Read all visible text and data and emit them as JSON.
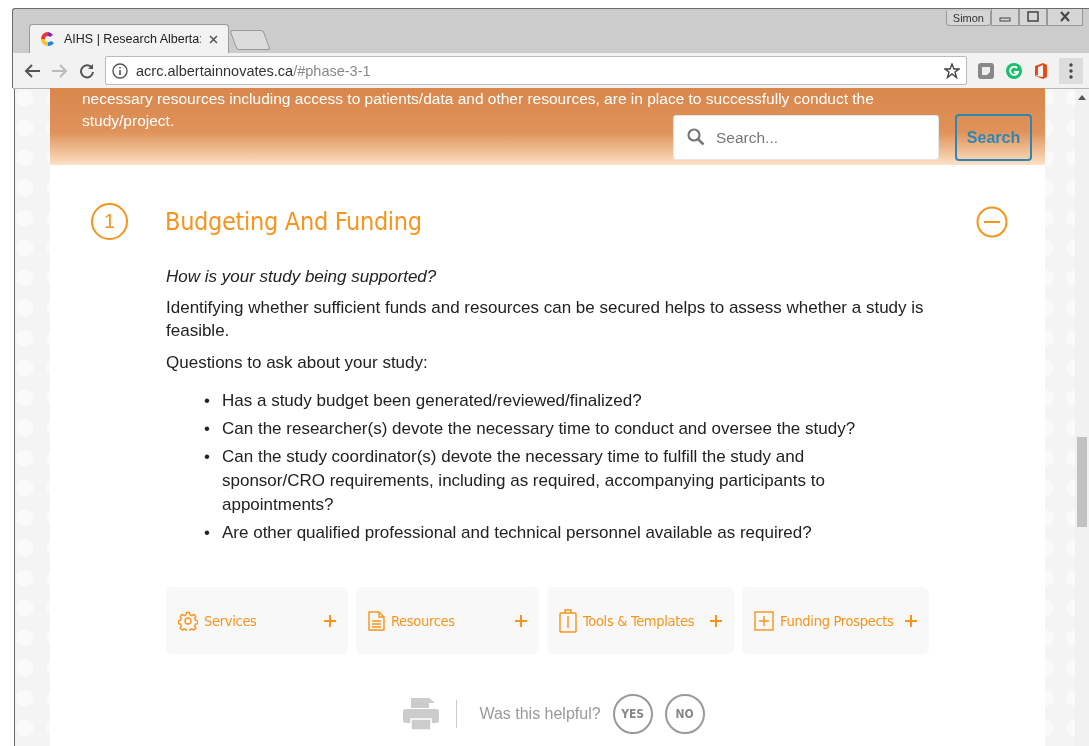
{
  "browser": {
    "tab_title": "AIHS | Research Alberta:",
    "profile": "Simon",
    "url_host": "acrc.albertainnovates.ca",
    "url_path": "/#phase-3-1"
  },
  "banner": {
    "text": "necessary resources including access to patients/data and other resources, are in place to successfully conduct the study/project.",
    "search": {
      "placeholder": "Search..."
    },
    "search_button": "Search"
  },
  "section": {
    "number": "1",
    "marker": "•",
    "title": "Budgeting And Funding",
    "expanded": true,
    "question": "How is your study being supported?",
    "paragraphs": [
      "Identifying whether sufficient funds and resources can be secured helps to assess whether a study is feasible.",
      "Questions to ask about your study:"
    ],
    "bullets": [
      "Has a study budget been generated/reviewed/finalized?",
      "Can the researcher(s) devote the necessary time to conduct and oversee the study?",
      "Can the study coordinator(s) devote the necessary time to fulfill the study and sponsor/CRO requirements, including as required, accompanying participants to appointments?",
      "Are other qualified professional and technical personnel available as required?"
    ]
  },
  "cards": [
    {
      "label": "Services",
      "kind": "gear"
    },
    {
      "label": "Resources",
      "kind": "document"
    },
    {
      "label": "Tools & Templates",
      "kind": "clipboard"
    },
    {
      "label": "Funding Prospects",
      "kind": "plus-box"
    }
  ],
  "feedback": {
    "prompt": "Was this helpful?",
    "buttons": [
      "YES",
      "NO"
    ]
  }
}
